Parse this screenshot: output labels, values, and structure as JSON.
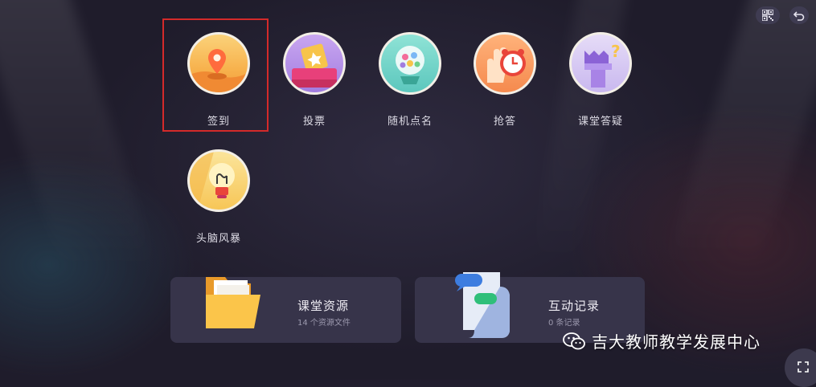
{
  "top_bar": {
    "qr_icon": "qr-code-icon",
    "back_icon": "return-icon"
  },
  "tools": [
    {
      "label": "签到",
      "icon": "location-pin-icon"
    },
    {
      "label": "投票",
      "icon": "ticket-box-icon"
    },
    {
      "label": "随机点名",
      "icon": "lottery-ball-icon"
    },
    {
      "label": "抢答",
      "icon": "hand-alarm-clock-icon"
    },
    {
      "label": "课堂答疑",
      "icon": "question-sign-icon"
    },
    {
      "label": "头脑风暴",
      "icon": "light-bulb-icon"
    }
  ],
  "selected_tool": "签到",
  "cards": {
    "resources": {
      "title": "课堂资源",
      "subtitle": "14 个资源文件",
      "icon": "folder-icon"
    },
    "records": {
      "title": "互动记录",
      "subtitle": "0 条记录",
      "icon": "chat-scroll-icon"
    }
  },
  "watermark": {
    "text": "吉大教师教学发展中心",
    "icon": "wechat-icon"
  },
  "fullscreen_icon": "fullscreen-icon",
  "colors": {
    "background": "#24212f",
    "card": "#37344a",
    "highlight_frame": "#d42a2a"
  }
}
